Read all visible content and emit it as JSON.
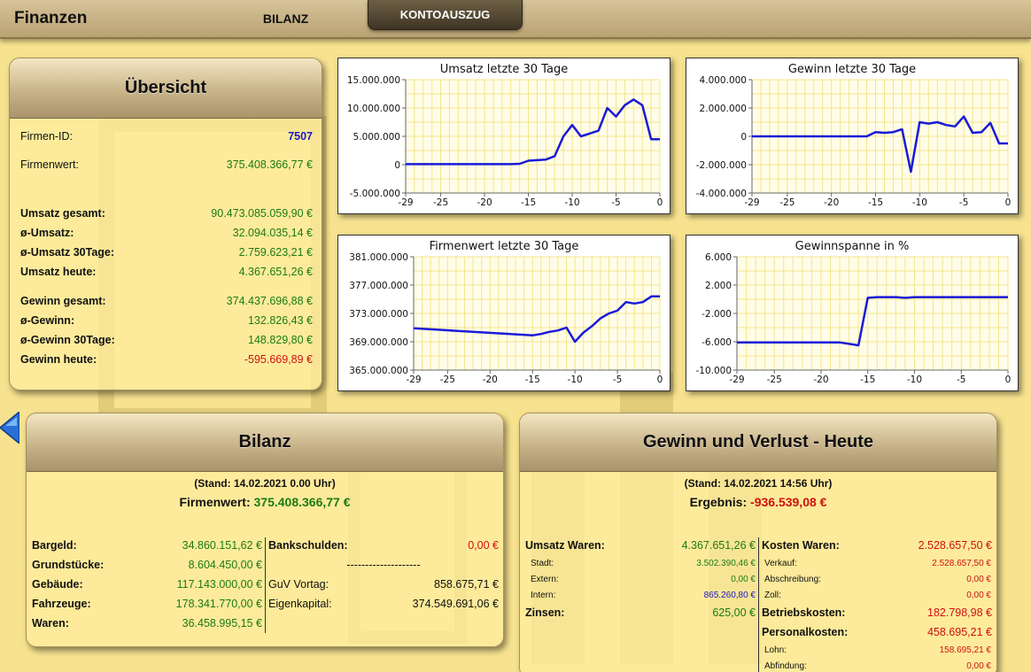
{
  "app": {
    "title": "Finanzen",
    "tabs": [
      {
        "label": "BILANZ",
        "active": false
      },
      {
        "label": "KONTOAUSZUG",
        "active": true
      }
    ]
  },
  "uebersicht": {
    "title": "Übersicht",
    "rows": [
      {
        "label": "Firmen-ID:",
        "value": "7507"
      },
      {
        "label": "Firmenwert:",
        "value": "375.408.366,77 €"
      },
      {
        "label": "Umsatz gesamt:",
        "value": "90.473.085.059,90 €"
      },
      {
        "label": "ø-Umsatz:",
        "value": "32.094.035,14 €"
      },
      {
        "label": "ø-Umsatz 30Tage:",
        "value": "2.759.623,21 €"
      },
      {
        "label": "Umsatz heute:",
        "value": "4.367.651,26 €"
      },
      {
        "label": "Gewinn gesamt:",
        "value": "374.437.696,88 €"
      },
      {
        "label": "ø-Gewinn:",
        "value": "132.826,43 €"
      },
      {
        "label": "ø-Gewinn 30Tage:",
        "value": "148.829,80 €"
      },
      {
        "label": "Gewinn heute:",
        "value": "-595.669,89 €"
      }
    ]
  },
  "chart_data": [
    {
      "type": "line",
      "title": "Umsatz letzte 30 Tage",
      "x": [
        -29,
        -28,
        -27,
        -26,
        -25,
        -24,
        -23,
        -22,
        -21,
        -20,
        -19,
        -18,
        -17,
        -16,
        -15,
        -14,
        -13,
        -12,
        -11,
        -10,
        -9,
        -8,
        -7,
        -6,
        -5,
        -4,
        -3,
        -2,
        -1,
        0
      ],
      "y": [
        100000,
        100000,
        100000,
        100000,
        100000,
        100000,
        100000,
        100000,
        100000,
        100000,
        100000,
        100000,
        100000,
        150000,
        700000,
        800000,
        900000,
        1500000,
        5000000,
        7000000,
        5000000,
        5500000,
        6000000,
        10000000,
        8500000,
        10500000,
        11500000,
        10500000,
        4500000,
        4500000
      ],
      "xticks": [
        -29,
        -25,
        -20,
        -15,
        -10,
        -5,
        0
      ],
      "yticks": [
        "15.000.000",
        "10.000.000",
        "5.000.000",
        "0",
        "-5.000.000"
      ],
      "ylim": [
        -5000000,
        15000000
      ],
      "color": "#1a1ad8"
    },
    {
      "type": "line",
      "title": "Gewinn letzte 30 Tage",
      "x": [
        -29,
        -28,
        -27,
        -26,
        -25,
        -24,
        -23,
        -22,
        -21,
        -20,
        -19,
        -18,
        -17,
        -16,
        -15,
        -14,
        -13,
        -12,
        -11,
        -10,
        -9,
        -8,
        -7,
        -6,
        -5,
        -4,
        -3,
        -2,
        -1,
        0
      ],
      "y": [
        0,
        0,
        0,
        0,
        0,
        0,
        0,
        0,
        0,
        0,
        0,
        0,
        0,
        0,
        300000,
        250000,
        300000,
        500000,
        -2500000,
        1000000,
        900000,
        1000000,
        800000,
        700000,
        1400000,
        250000,
        300000,
        950000,
        -500000,
        -500000
      ],
      "xticks": [
        -29,
        -25,
        -20,
        -15,
        -10,
        -5,
        0
      ],
      "yticks": [
        "4.000.000",
        "2.000.000",
        "0",
        "-2.000.000",
        "-4.000.000"
      ],
      "ylim": [
        -4000000,
        4000000
      ],
      "color": "#1a1ad8"
    },
    {
      "type": "line",
      "title": "Firmenwert letzte 30 Tage",
      "x": [
        -29,
        -15,
        -14,
        -13,
        -12,
        -11,
        -10,
        -9,
        -8,
        -7,
        -6,
        -5,
        -4,
        -3,
        -2,
        -1,
        0
      ],
      "y": [
        370900000,
        369900000,
        370100000,
        370400000,
        370600000,
        371000000,
        369000000,
        370300000,
        371200000,
        372300000,
        373000000,
        373400000,
        374600000,
        374400000,
        374600000,
        375400000,
        375400000
      ],
      "xticks": [
        -29,
        -25,
        -20,
        -15,
        -10,
        -5,
        0
      ],
      "yticks": [
        "381.000.000",
        "377.000.000",
        "373.000.000",
        "369.000.000",
        "365.000.000"
      ],
      "ylim": [
        365000000,
        381000000
      ],
      "color": "#1a1ad8"
    },
    {
      "type": "line",
      "title": "Gewinnspanne in %",
      "x": [
        -29,
        -18,
        -17,
        -16,
        -15,
        -14,
        -13,
        -12,
        -11,
        -10,
        -9,
        0
      ],
      "y": [
        -6.1,
        -6.1,
        -6.3,
        -6.5,
        0.2,
        0.3,
        0.3,
        0.3,
        0.2,
        0.3,
        0.3,
        0.3
      ],
      "xticks": [
        -29,
        -25,
        -20,
        -15,
        -10,
        -5,
        0
      ],
      "yticks": [
        "6.000",
        "2.000",
        "-2.000",
        "-6.000",
        "-10.000"
      ],
      "ylim": [
        -10,
        6
      ],
      "color": "#1a1ad8"
    }
  ],
  "bilanz": {
    "title": "Bilanz",
    "stand": "(Stand: 14.02.2021 0.00 Uhr)",
    "summary_label": "Firmenwert:",
    "summary_value": "375.408.366,77 €",
    "aktiva": [
      {
        "label": "Bargeld:",
        "value": "34.860.151,62 €"
      },
      {
        "label": "Grundstücke:",
        "value": "8.604.450,00 €"
      },
      {
        "label": "Gebäude:",
        "value": "117.143.000,00 €"
      },
      {
        "label": "Fahrzeuge:",
        "value": "178.341.770,00 €"
      },
      {
        "label": "Waren:",
        "value": "36.458.995,15 €"
      }
    ],
    "passiva": [
      {
        "label": "Bankschulden:",
        "value": "0,00 €"
      },
      {
        "label": "",
        "value": "--------------------"
      },
      {
        "label": "GuV Vortag:",
        "value": "858.675,71 €"
      },
      {
        "label": "Eigenkapital:",
        "value": "374.549.691,06 €"
      }
    ]
  },
  "guv": {
    "title": "Gewinn und Verlust - Heute",
    "stand": "(Stand: 14.02.2021 14:56 Uhr)",
    "summary_label": "Ergebnis:",
    "summary_value": "-936.539,08 €",
    "left": [
      {
        "label": "Umsatz Waren:",
        "value": "4.367.651,26 €",
        "size": "big"
      },
      {
        "label": "Stadt:",
        "value": "3.502.390,46 €",
        "size": "small"
      },
      {
        "label": "Extern:",
        "value": "0,00 €",
        "size": "small"
      },
      {
        "label": "Intern:",
        "value": "865.260,80 €",
        "size": "small"
      },
      {
        "label": "Zinsen:",
        "value": "625,00 €",
        "size": "big"
      }
    ],
    "right": [
      {
        "label": "Kosten Waren:",
        "value": "2.528.657,50 €",
        "size": "big"
      },
      {
        "label": "Verkauf:",
        "value": "2.528.657,50 €",
        "size": "small"
      },
      {
        "label": "Abschreibung:",
        "value": "0,00 €",
        "size": "small"
      },
      {
        "label": "Zoll:",
        "value": "0,00 €",
        "size": "small"
      },
      {
        "label": "Betriebskosten:",
        "value": "182.798,98 €",
        "size": "big"
      },
      {
        "label": "Personalkosten:",
        "value": "458.695,21 €",
        "size": "big"
      },
      {
        "label": "Lohn:",
        "value": "158.695,21 €",
        "size": "small"
      },
      {
        "label": "Abfindung:",
        "value": "0,00 €",
        "size": "small"
      }
    ]
  },
  "colors": {
    "background": "#f7e28f",
    "positive": "#1d7a14",
    "negative": "#d01010",
    "link": "#1a16c8"
  }
}
